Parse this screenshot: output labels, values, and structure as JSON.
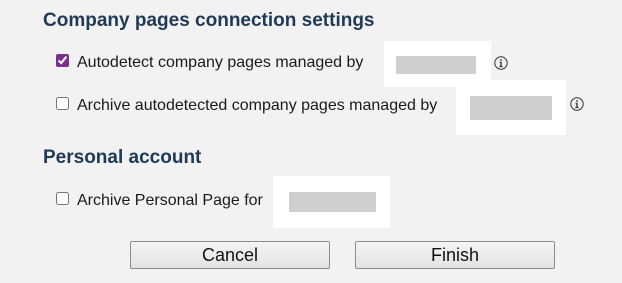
{
  "company_section": {
    "title": "Company pages connection settings",
    "options": [
      {
        "label": "Autodetect company pages managed by",
        "checked": true
      },
      {
        "label": "Archive autodetected company pages managed by",
        "checked": false
      }
    ]
  },
  "personal_section": {
    "title": "Personal account",
    "options": [
      {
        "label": "Archive Personal Page for",
        "checked": false
      }
    ]
  },
  "buttons": {
    "cancel": "Cancel",
    "finish": "Finish"
  },
  "icons": {
    "info": "info-icon"
  },
  "colors": {
    "heading": "#1e3a57",
    "checkbox_checked": "#7a2f8c",
    "redaction": "#cfcfcf"
  }
}
